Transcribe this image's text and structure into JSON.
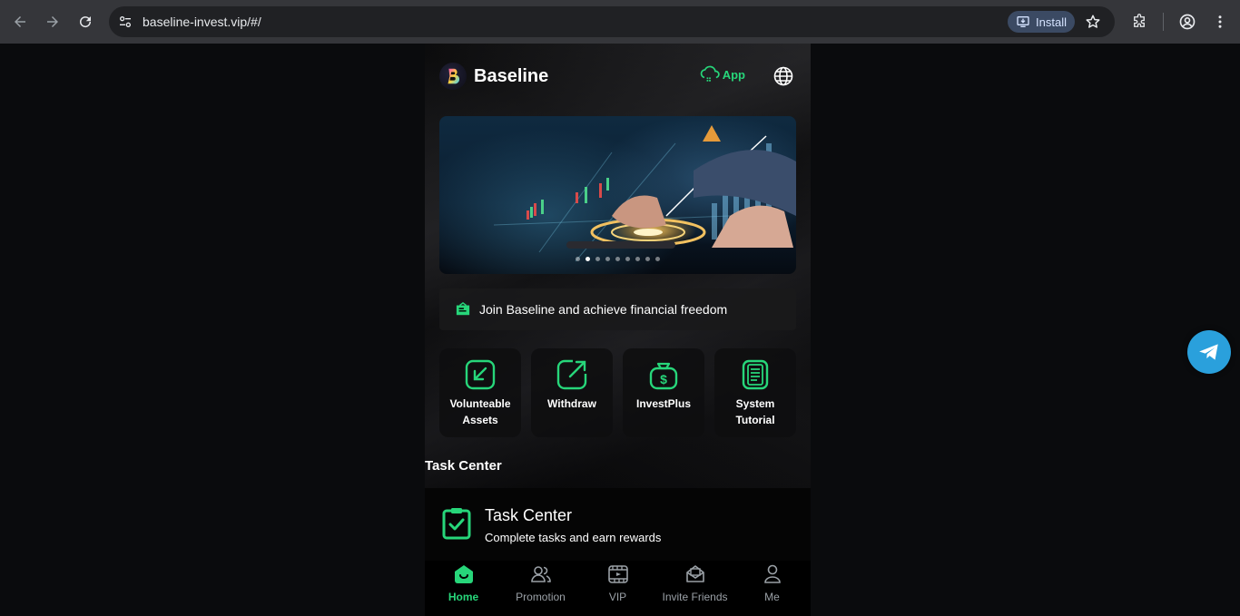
{
  "browser": {
    "url": "baseline-invest.vip/#/",
    "install_label": "Install"
  },
  "header": {
    "brand": "Baseline",
    "app_label": "App"
  },
  "banner": {
    "slide_count": 9,
    "active_slide": 2
  },
  "notice": {
    "text": "Join Baseline and achieve financial freedom"
  },
  "quick_actions": [
    {
      "label": "Volunteable Assets",
      "icon": "arrow-down-left-icon"
    },
    {
      "label": "Withdraw",
      "icon": "arrow-up-right-icon"
    },
    {
      "label": "InvestPlus",
      "icon": "money-bag-icon"
    },
    {
      "label": "System Tutorial",
      "icon": "document-icon"
    }
  ],
  "task_section": {
    "title": "Task Center",
    "card_title": "Task Center",
    "card_subtitle": "Complete tasks and earn rewards"
  },
  "bottom_nav": [
    {
      "label": "Home",
      "active": true
    },
    {
      "label": "Promotion",
      "active": false
    },
    {
      "label": "VIP",
      "active": false
    },
    {
      "label": "Invite Friends",
      "active": false
    },
    {
      "label": "Me",
      "active": false
    }
  ],
  "colors": {
    "accent": "#27d67a",
    "background": "#000000",
    "telegram": "#2aa0dc"
  }
}
